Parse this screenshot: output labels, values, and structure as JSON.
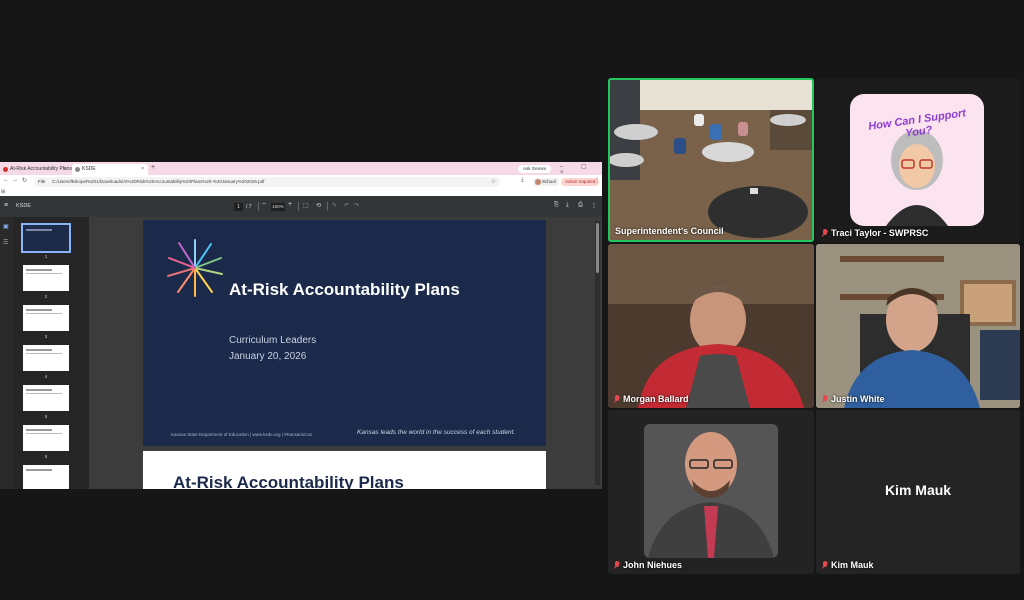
{
  "browser": {
    "tabs": [
      {
        "label": "At-Risk Accountability Plans",
        "close": "×"
      },
      {
        "label": "KSDE",
        "close": "×"
      }
    ],
    "new_tab": "+",
    "gemini_label": "Ask Gemini",
    "window_controls": "– ▢ ×",
    "nav": {
      "back": "←",
      "forward": "→",
      "reload": "↻"
    },
    "file_chip": "File",
    "url": "C:/Users/lkskopel%201/Downloads/At%20Risk%20Accountability%20Plans%20-%20January%202026.pdf",
    "profile_label": "School",
    "action_required": "Action required",
    "kebab": "⋮",
    "apps_icon": "⊞"
  },
  "pdf": {
    "menu_icon": "≡",
    "title": "KSDE",
    "page_current": "1",
    "page_total": "/ 7",
    "zoom": "100%",
    "zoom_minus": "−",
    "zoom_plus": "+",
    "thumbnail_numbers": [
      "1",
      "2",
      "3",
      "4",
      "5",
      "6",
      "7"
    ],
    "slide1": {
      "title": "At-Risk Accountability Plans",
      "subtitle": "Curriculum Leaders",
      "date": "January 20, 2026",
      "footer": "Kansas State Department of Education | www.ksde.org | #KansansCan",
      "tagline": "Kansas leads the world in the success of each student."
    },
    "slide2": {
      "title": "At-Risk Accountability Plans"
    }
  },
  "participants": {
    "council": {
      "name": "Superintendent's Council"
    },
    "traci": {
      "name": "Traci Taylor - SWPRSC",
      "avatar_text": "How Can I Support You?"
    },
    "morgan": {
      "name": "Morgan Ballard"
    },
    "justin": {
      "name": "Justin White"
    },
    "john": {
      "name": "John Niehues"
    },
    "kim": {
      "name": "Kim Mauk",
      "center_name": "Kim Mauk"
    }
  },
  "colors": {
    "active_speaker": "#22c55e",
    "muted_mic": "#e5484d",
    "slide_navy": "#1b2a4b"
  }
}
